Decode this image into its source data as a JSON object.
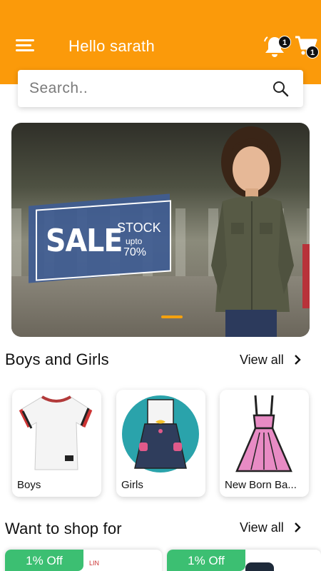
{
  "header": {
    "greeting": "Hello sarath",
    "notification_count": "1",
    "cart_count": "1",
    "icons": {
      "menu": "menu-icon",
      "bell": "bell-icon",
      "cart": "cart-icon"
    },
    "colors": {
      "background": "#fb9a0a",
      "text": "#ffffff"
    }
  },
  "search": {
    "placeholder": "Search..",
    "value": "",
    "icon": "search-icon"
  },
  "banner": {
    "sale": "SALE",
    "stock": "STOCK",
    "upto": "upto",
    "percent": "70%",
    "active_slide_indicator_color": "#f4a10e"
  },
  "categories_section": {
    "title": "Boys and Girls",
    "view_all": "View all",
    "items": [
      {
        "label": "Boys"
      },
      {
        "label": "Girls"
      },
      {
        "label": "New Born Ba..."
      }
    ]
  },
  "shop_section": {
    "title": "Want to shop for",
    "view_all": "View all",
    "items": [
      {
        "badge": "1% Off",
        "label_fragment": "LIN"
      },
      {
        "badge": "1% Off"
      }
    ],
    "badge_color": "#3cbf72"
  }
}
